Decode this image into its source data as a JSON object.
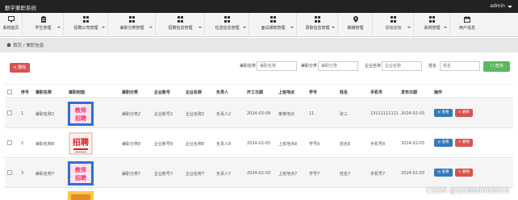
{
  "app": {
    "title": "勤学兼职系统",
    "user": "admin"
  },
  "nav": [
    {
      "label": "系统首页",
      "icon": "monitor-icon"
    },
    {
      "label": "学生管理",
      "icon": "clipboard-icon"
    },
    {
      "label": "招聘公司管理",
      "icon": "grid-icon"
    },
    {
      "label": "兼职分类管理",
      "icon": "grid-icon"
    },
    {
      "label": "招聘信息管理",
      "icon": "grid-icon"
    },
    {
      "label": "任选信息管理",
      "icon": "grid-icon"
    },
    {
      "label": "面试通知管理",
      "icon": "grid-icon"
    },
    {
      "label": "录取信息管理",
      "icon": "grid-icon"
    },
    {
      "label": "薪酬管理",
      "icon": "location-icon"
    },
    {
      "label": "论坛论坛",
      "icon": "grid-icon"
    },
    {
      "label": "系统管理",
      "icon": "grid-icon"
    },
    {
      "label": "用户信息",
      "icon": "calendar-icon"
    }
  ],
  "breadcrumb": {
    "text": "首页 / 兼职信息"
  },
  "search": {
    "delete_label": "× 删除",
    "fields": [
      {
        "label": "兼职名称",
        "placeholder": "兼职名称"
      },
      {
        "label": "兼职分类",
        "placeholder": "兼职分类"
      },
      {
        "label": "企业名称",
        "placeholder": "企业名称"
      },
      {
        "label": "姓名",
        "placeholder": "姓名"
      }
    ],
    "search_label": "☐ 查询"
  },
  "table": {
    "headers": [
      "序号",
      "兼职名称",
      "兼职封面",
      "兼职分类",
      "企业账号",
      "企业名称",
      "负责人",
      "开工日期",
      "上班地点",
      "学号",
      "姓名",
      "手机号",
      "发布日期",
      "操作"
    ],
    "rows": [
      {
        "no": "1",
        "name": "兼职名称2",
        "cover": "teacher",
        "category": "兼职分类2",
        "account": "企业账号2",
        "company": "企业名称2",
        "manager": "负责人2",
        "start": "2024-03-09",
        "place": "某某地点",
        "sid": "11",
        "sname": "张三",
        "phone": "13111111111",
        "date": "2024-02-03"
      },
      {
        "no": "2",
        "name": "兼职名称8",
        "cover": "recruit",
        "category": "兼职分类8",
        "account": "企业账号8",
        "company": "企业名称8",
        "manager": "负责人8",
        "start": "2024-02-03",
        "place": "上班地点8",
        "sid": "学号8",
        "sname": "姓名8",
        "phone": "手机号8",
        "date": "2024-02-03"
      },
      {
        "no": "3",
        "name": "兼职名称7",
        "cover": "teacher",
        "category": "兼职分类7",
        "account": "企业账号7",
        "company": "企业名称7",
        "manager": "负责人7",
        "start": "2024-02-03",
        "place": "上班地点7",
        "sid": "学号7",
        "sname": "姓名7",
        "phone": "手机号7",
        "date": "2024-02-03"
      }
    ],
    "view_label": "◎ 查看",
    "delete_label": "× 删除"
  },
  "cover_text": {
    "teacher_top": "教师",
    "teacher_bottom": "招聘",
    "recruit": "招聘"
  },
  "watermark": "CSDN @QQ860060016",
  "colors": {
    "topbar": "#222222",
    "danger": "#d9534f",
    "primary": "#337ab7",
    "success": "#5cb85c"
  }
}
